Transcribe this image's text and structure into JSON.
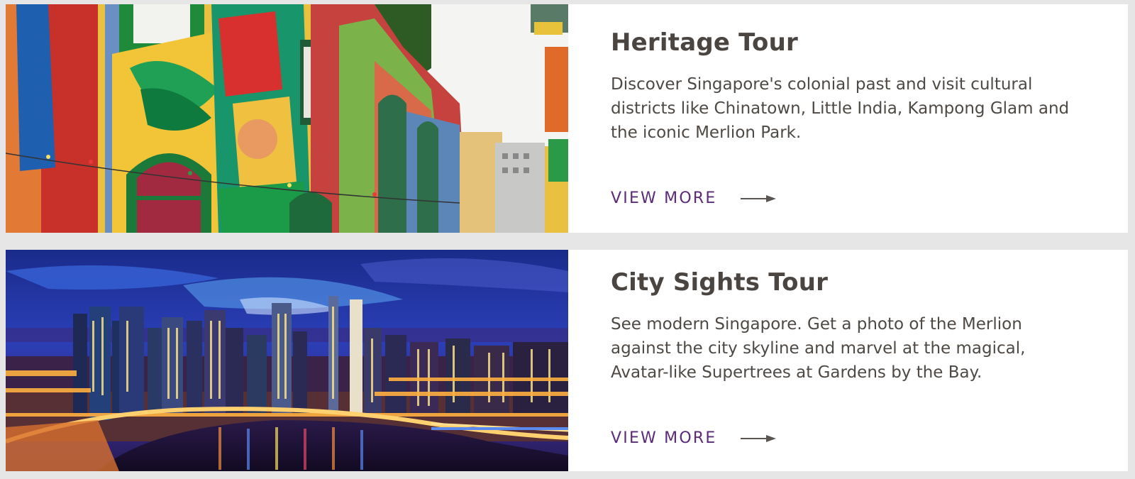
{
  "tours": [
    {
      "title": "Heritage Tour",
      "description": "Discover Singapore's colonial past and visit cultural districts like Chinatown, Little India, Kampong Glam and the iconic Merlion Park.",
      "cta_label": "VIEW MORE",
      "image_icon": "street-mural-photo",
      "arrow_icon": "arrow-right-icon"
    },
    {
      "title": "City Sights Tour",
      "description": "See modern Singapore. Get a photo of the Merlion against the city skyline and marvel at the magical, Avatar-like Supertrees at Gardens by the Bay.",
      "cta_label": "VIEW MORE",
      "image_icon": "city-skyline-night-photo",
      "arrow_icon": "arrow-right-icon"
    }
  ],
  "colors": {
    "background": "#e6e6e6",
    "card": "#ffffff",
    "title": "#4a4540",
    "text": "#4e4944",
    "accent": "#5b2a78",
    "arrow": "#5a5550"
  }
}
